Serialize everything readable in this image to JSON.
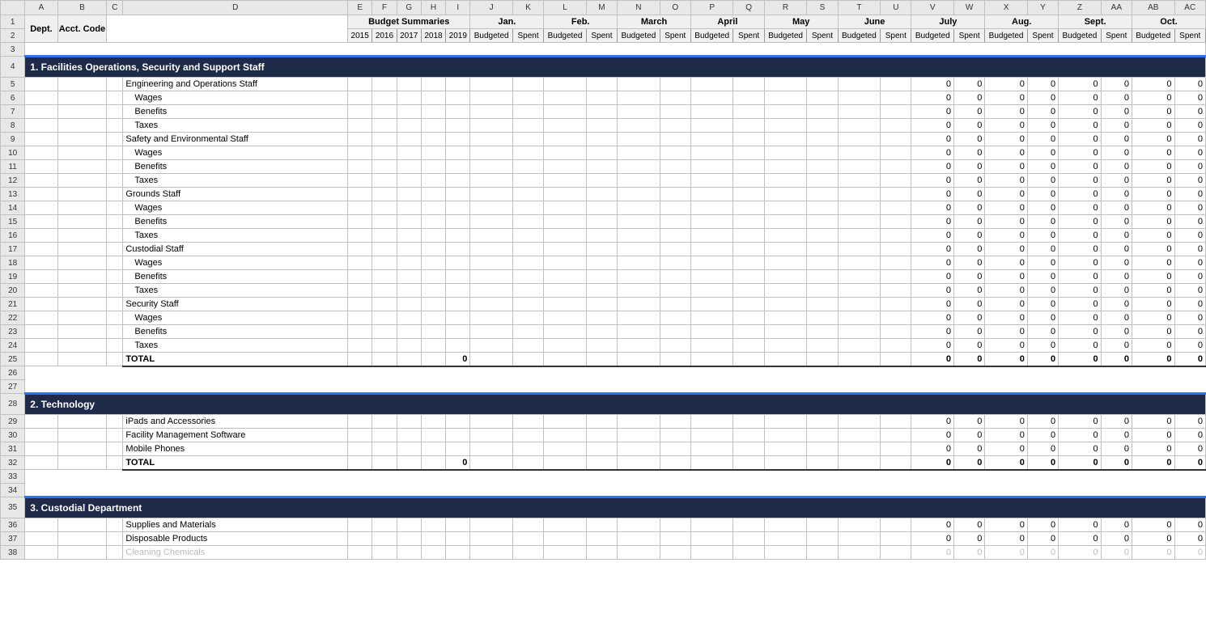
{
  "cols": [
    "",
    "A",
    "B",
    "C",
    "D",
    "E",
    "F",
    "G",
    "H",
    "I",
    "J",
    "K",
    "L",
    "M",
    "N",
    "O",
    "P",
    "Q",
    "R",
    "S",
    "T",
    "U",
    "V",
    "W",
    "X",
    "Y",
    "Z",
    "AA",
    "AB",
    "AC"
  ],
  "hdr1": {
    "dept": "Dept.",
    "acct": "Acct. Code",
    "budg": "Budget Summaries",
    "months": [
      "Jan.",
      "Feb.",
      "March",
      "April",
      "May",
      "June",
      "July",
      "Aug.",
      "Sept.",
      "Oct."
    ]
  },
  "hdr2": {
    "years": [
      "2015",
      "2016",
      "2017",
      "2018",
      "2019"
    ],
    "b": "Budgeted",
    "s": "Spent"
  },
  "sections": [
    {
      "title": "1. Facilities Operations, Security and Support Staff",
      "startRow": 4,
      "rows": [
        {
          "n": 5,
          "lbl": "Engineering and Operations Staff",
          "ind": 0
        },
        {
          "n": 6,
          "lbl": "Wages",
          "ind": 1
        },
        {
          "n": 7,
          "lbl": "Benefits",
          "ind": 1
        },
        {
          "n": 8,
          "lbl": "Taxes",
          "ind": 1
        },
        {
          "n": 9,
          "lbl": "Safety and Environmental Staff",
          "ind": 0
        },
        {
          "n": 10,
          "lbl": "Wages",
          "ind": 1
        },
        {
          "n": 11,
          "lbl": "Benefits",
          "ind": 1
        },
        {
          "n": 12,
          "lbl": "Taxes",
          "ind": 1
        },
        {
          "n": 13,
          "lbl": "Grounds Staff",
          "ind": 0
        },
        {
          "n": 14,
          "lbl": "Wages",
          "ind": 1
        },
        {
          "n": 15,
          "lbl": "Benefits",
          "ind": 1
        },
        {
          "n": 16,
          "lbl": "Taxes",
          "ind": 1
        },
        {
          "n": 17,
          "lbl": "Custodial Staff",
          "ind": 0
        },
        {
          "n": 18,
          "lbl": "Wages",
          "ind": 1
        },
        {
          "n": 19,
          "lbl": "Benefits",
          "ind": 1
        },
        {
          "n": 20,
          "lbl": "Taxes",
          "ind": 1
        },
        {
          "n": 21,
          "lbl": "Security Staff",
          "ind": 0
        },
        {
          "n": 22,
          "lbl": "Wages",
          "ind": 1
        },
        {
          "n": 23,
          "lbl": "Benefits",
          "ind": 1
        },
        {
          "n": 24,
          "lbl": "Taxes",
          "ind": 1
        }
      ],
      "totalRow": 25,
      "totalLbl": "TOTAL",
      "blankRows": [
        26,
        27
      ]
    },
    {
      "title": "2. Technology",
      "startRow": 28,
      "rows": [
        {
          "n": 29,
          "lbl": "iPads and Accessories",
          "ind": 0
        },
        {
          "n": 30,
          "lbl": "Facility Management Software",
          "ind": 0
        },
        {
          "n": 31,
          "lbl": "Mobile Phones",
          "ind": 0
        }
      ],
      "totalRow": 32,
      "totalLbl": "TOTAL",
      "blankRows": [
        33,
        34
      ]
    },
    {
      "title": "3. Custodial Department",
      "startRow": 35,
      "rows": [
        {
          "n": 36,
          "lbl": "Supplies and Materials",
          "ind": 0
        },
        {
          "n": 37,
          "lbl": "Disposable Products",
          "ind": 0
        },
        {
          "n": 38,
          "lbl": "Cleaning Chemicals",
          "ind": 0,
          "faded": true
        }
      ]
    }
  ],
  "zeroVal": "0"
}
